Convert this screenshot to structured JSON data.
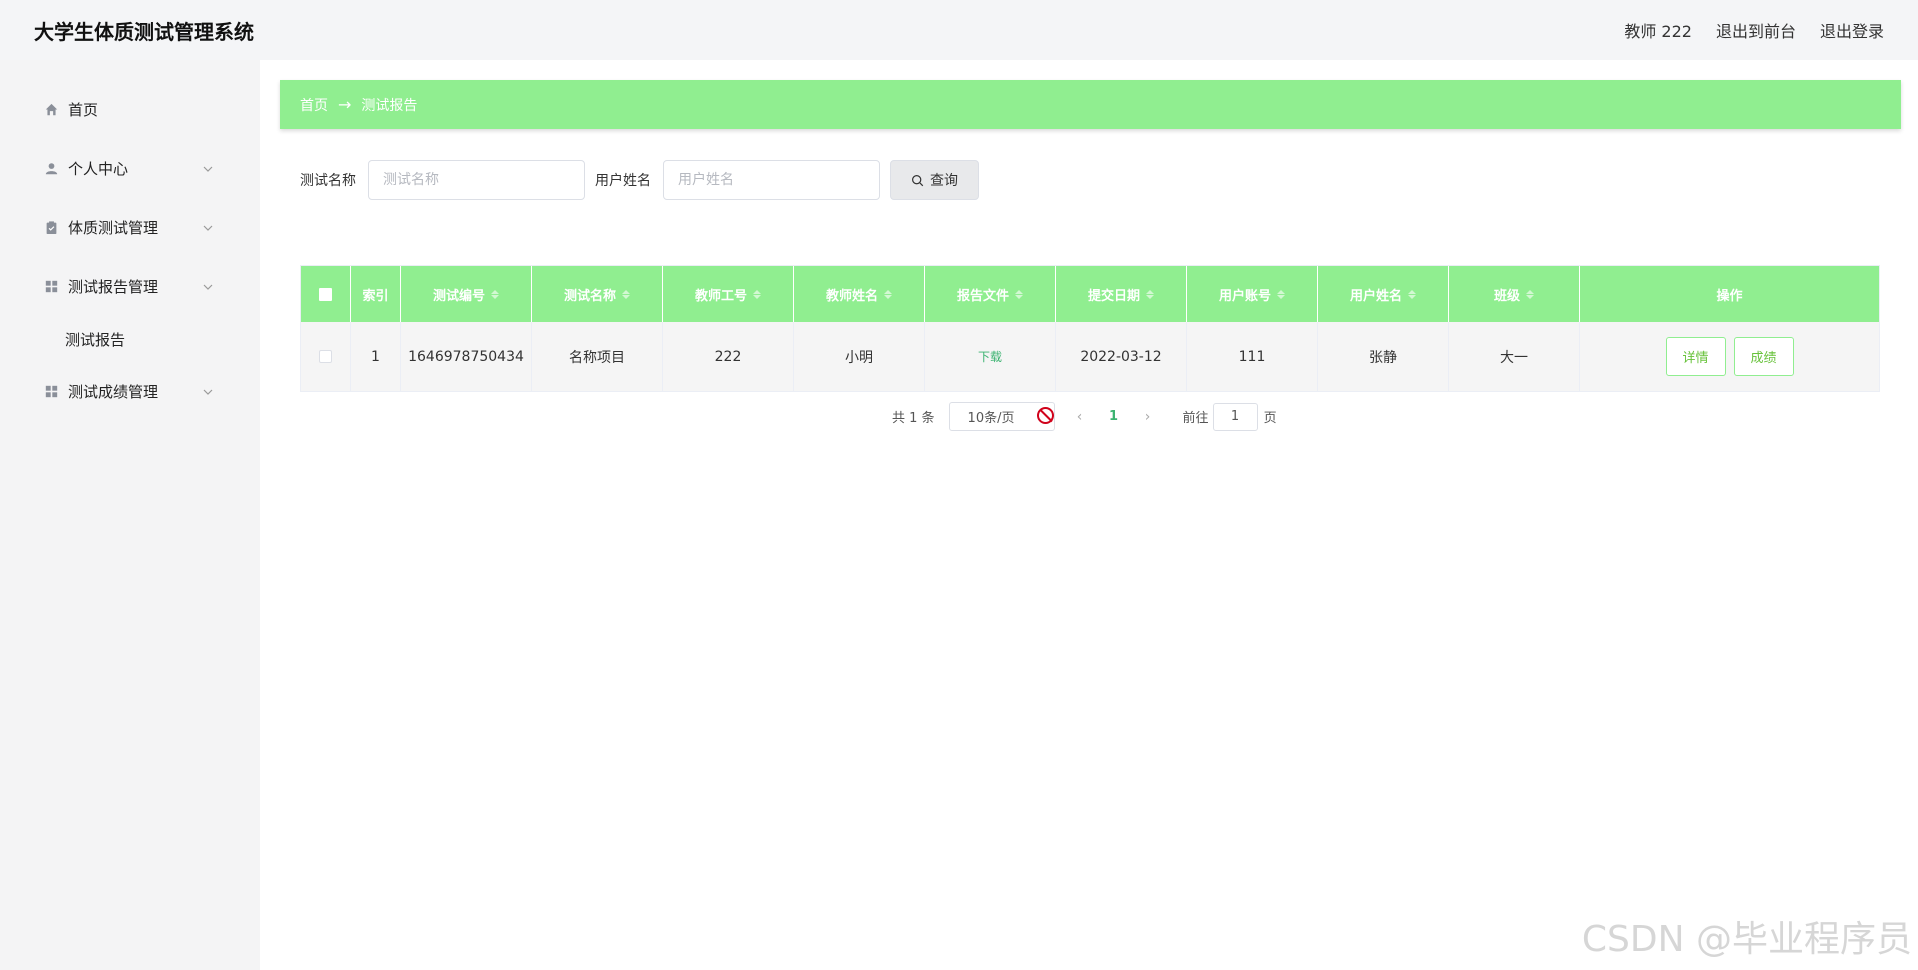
{
  "header": {
    "title": "大学生体质测试管理系统",
    "user": "教师 222",
    "exit_front": "退出到前台",
    "logout": "退出登录"
  },
  "sidebar": {
    "items": [
      {
        "label": "首页",
        "icon": "home-icon"
      },
      {
        "label": "个人中心",
        "icon": "user-icon"
      },
      {
        "label": "体质测试管理",
        "icon": "clipboard-icon"
      },
      {
        "label": "测试报告管理",
        "icon": "grid-icon"
      },
      {
        "label": "测试报告",
        "icon": ""
      },
      {
        "label": "测试成绩管理",
        "icon": "grid-icon"
      }
    ]
  },
  "breadcrumb": {
    "home": "首页",
    "arrow": "→",
    "current": "测试报告"
  },
  "search": {
    "name_label": "测试名称",
    "name_placeholder": "测试名称",
    "user_label": "用户姓名",
    "user_placeholder": "用户姓名",
    "query_button": "查询"
  },
  "table": {
    "headers": [
      "",
      "索引",
      "测试编号",
      "测试名称",
      "教师工号",
      "教师姓名",
      "报告文件",
      "提交日期",
      "用户账号",
      "用户姓名",
      "班级",
      "操作"
    ],
    "rows": [
      {
        "index": "1",
        "test_no": "1646978750434",
        "test_name": "名称项目",
        "teacher_no": "222",
        "teacher_name": "小明",
        "report_file": "下载",
        "submit_date": "2022-03-12",
        "user_account": "111",
        "user_name": "张静",
        "class": "大一",
        "detail_btn": "详情",
        "score_btn": "成绩"
      }
    ]
  },
  "pagination": {
    "total": "共 1 条",
    "page_size": "10条/页",
    "current": "1",
    "goto_label": "前往",
    "goto_value": "1",
    "page_suffix": "页"
  },
  "watermark": "CSDN @毕业程序员",
  "colors": {
    "accent": "#90ee90",
    "link": "#3cb371"
  }
}
